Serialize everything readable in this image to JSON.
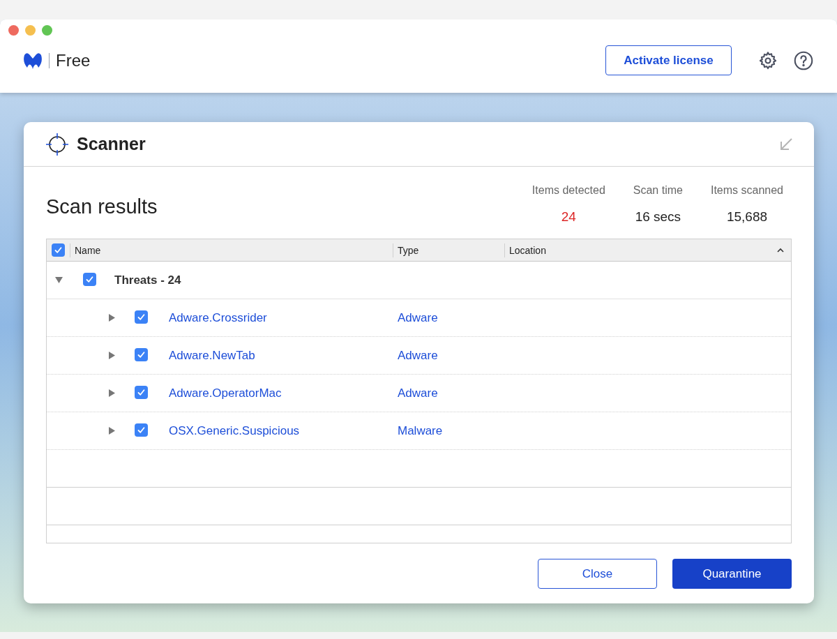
{
  "app": {
    "edition": "Free",
    "activate_button": "Activate license"
  },
  "scanner": {
    "title": "Scanner",
    "heading": "Scan results",
    "stats": [
      {
        "label": "Items detected",
        "value": "24",
        "kind": "alert"
      },
      {
        "label": "Scan time",
        "value": "16 secs",
        "kind": "plain"
      },
      {
        "label": "Items scanned",
        "value": "15,688",
        "kind": "plain"
      }
    ],
    "table": {
      "select_all_checked": true,
      "columns": [
        "Name",
        "Type",
        "Location"
      ],
      "groups": [
        {
          "label": "Threats - 24",
          "checked": true,
          "expanded": true,
          "children": [
            {
              "name": "Adware.Crossrider",
              "type": "Adware",
              "checked": true,
              "expanded": false
            },
            {
              "name": "Adware.NewTab",
              "type": "Adware",
              "checked": true,
              "expanded": false
            },
            {
              "name": "Adware.OperatorMac",
              "type": "Adware",
              "checked": true,
              "expanded": false
            },
            {
              "name": "OSX.Generic.Suspicious",
              "type": "Malware",
              "checked": true,
              "expanded": false
            }
          ]
        }
      ]
    },
    "buttons": [
      {
        "label": "Close",
        "kind": "secondary"
      },
      {
        "label": "Quarantine",
        "kind": "primary"
      }
    ]
  }
}
